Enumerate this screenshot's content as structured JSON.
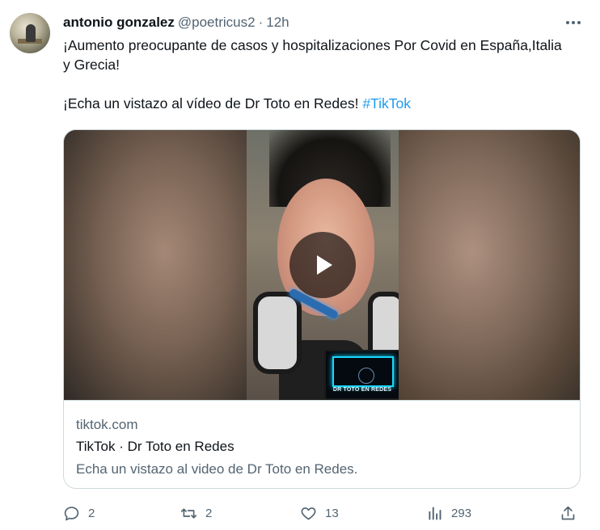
{
  "author": {
    "name": "antonio gonzalez",
    "handle": "@poetricus2",
    "separator": "·",
    "time": "12h"
  },
  "tweet": {
    "line1": "¡Aumento preocupante de casos y hospitalizaciones Por Covid en España,Italia y Grecia!",
    "line2_text": "¡Echa un vistazo al vídeo de Dr Toto en Redes! ",
    "hashtag": "#TikTok"
  },
  "card": {
    "overlay_logo_text": "DR TOTO EN REDES",
    "domain": "tiktok.com",
    "title": "TikTok · Dr Toto en Redes",
    "description": "Echa un vistazo al video de Dr Toto en Redes."
  },
  "actions": {
    "replies": "2",
    "reposts": "2",
    "likes": "13",
    "views": "293"
  },
  "icons": {
    "more": "more-dots-icon",
    "reply": "reply-icon",
    "repost": "repost-icon",
    "like": "heart-icon",
    "views": "views-chart-icon",
    "share": "share-icon",
    "play": "play-icon"
  },
  "colors": {
    "link": "#1d9bf0",
    "secondary_text": "#536471",
    "primary_text": "#0f1419",
    "border": "#cfd9de"
  }
}
